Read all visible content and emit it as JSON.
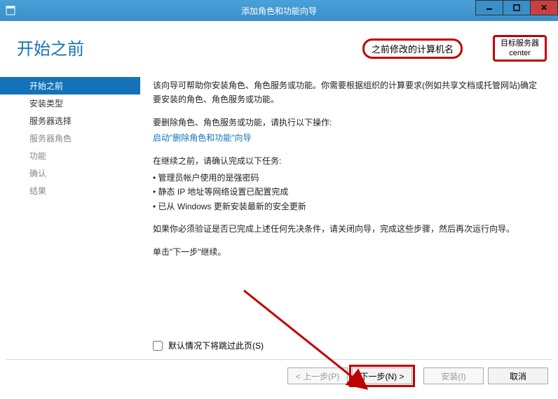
{
  "window": {
    "title": "添加角色和功能向导"
  },
  "header": {
    "page_title": "开始之前",
    "callout_left": "之前修改的计算机名",
    "callout_right_line1": "目标服务器",
    "callout_right_line2": "center"
  },
  "sidebar": {
    "items": [
      {
        "label": "开始之前",
        "state": "active"
      },
      {
        "label": "安装类型",
        "state": "enabled"
      },
      {
        "label": "服务器选择",
        "state": "enabled"
      },
      {
        "label": "服务器角色",
        "state": "disabled"
      },
      {
        "label": "功能",
        "state": "disabled"
      },
      {
        "label": "确认",
        "state": "disabled"
      },
      {
        "label": "结果",
        "state": "disabled"
      }
    ]
  },
  "content": {
    "p1": "该向导可帮助你安装角色、角色服务或功能。你需要根据组织的计算要求(例如共享文档或托管网站)确定要安装的角色、角色服务或功能。",
    "p2": "要删除角色、角色服务或功能，请执行以下操作:",
    "link": "启动\"删除角色和功能\"向导",
    "p3": "在继续之前，请确认完成以下任务:",
    "bullets": [
      "管理员帐户使用的是强密码",
      "静态 IP 地址等网络设置已配置完成",
      "已从 Windows 更新安装最新的安全更新"
    ],
    "p4": "如果你必须验证是否已完成上述任何先决条件，请关闭向导，完成这些步骤，然后再次运行向导。",
    "p5": "单击\"下一步\"继续。",
    "skip_label": "默认情况下将跳过此页(S)"
  },
  "footer": {
    "prev": "< 上一步(P)",
    "next": "下一步(N) >",
    "install": "安装(I)",
    "cancel": "取消"
  }
}
